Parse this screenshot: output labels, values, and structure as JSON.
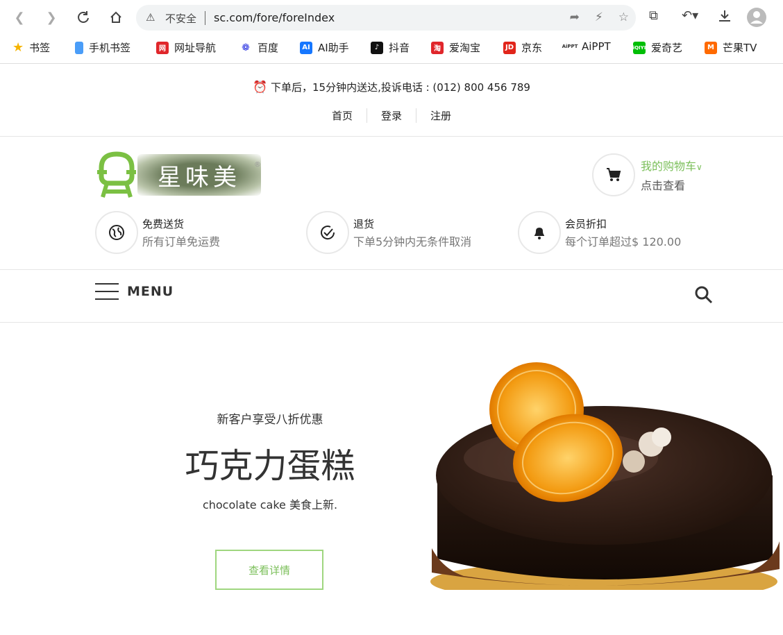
{
  "browser": {
    "security_label": "不安全",
    "url": "sc.com/fore/foreIndex"
  },
  "bookmarks": [
    {
      "label": "书签",
      "color": "#f6b400"
    },
    {
      "label": "手机书签",
      "color": "#4a9df8"
    },
    {
      "label": "网址导航",
      "color": "#e0262b"
    },
    {
      "label": "百度",
      "color": "#2932e1"
    },
    {
      "label": "AI助手",
      "color": "#1677ff"
    },
    {
      "label": "抖音",
      "color": "#111111"
    },
    {
      "label": "爱淘宝",
      "color": "#e0262b"
    },
    {
      "label": "京东",
      "color": "#e1251b"
    },
    {
      "label": "AiPPT",
      "color": "#333333"
    },
    {
      "label": "爱奇艺",
      "color": "#00be06"
    },
    {
      "label": "芒果TV",
      "color": "#ff6a00"
    }
  ],
  "topbar": {
    "notice": "下单后，15分钟内送达,投诉电话 : (012) 800 456 789",
    "links": [
      "首页",
      "登录",
      "注册"
    ]
  },
  "header": {
    "logo_text": "星味美",
    "cart_title": "我的购物车",
    "cart_sub": "点击查看"
  },
  "features": [
    {
      "title": "免费送货",
      "desc": "所有订单免运费",
      "icon": "globe-icon"
    },
    {
      "title": "退货",
      "desc": "下单5分钟内无条件取消",
      "icon": "check-icon"
    },
    {
      "title": "会员折扣",
      "desc": "每个订单超过$ 120.00",
      "icon": "bell-icon"
    }
  ],
  "nav": {
    "menu_label": "MENU"
  },
  "hero": {
    "subtitle": "新客户享受八折优惠",
    "title": "巧克力蛋糕",
    "description": "chocolate cake 美食上新.",
    "button": "查看详情"
  },
  "colors": {
    "accent": "#7bbf5a",
    "button_border": "#9fd67f"
  }
}
